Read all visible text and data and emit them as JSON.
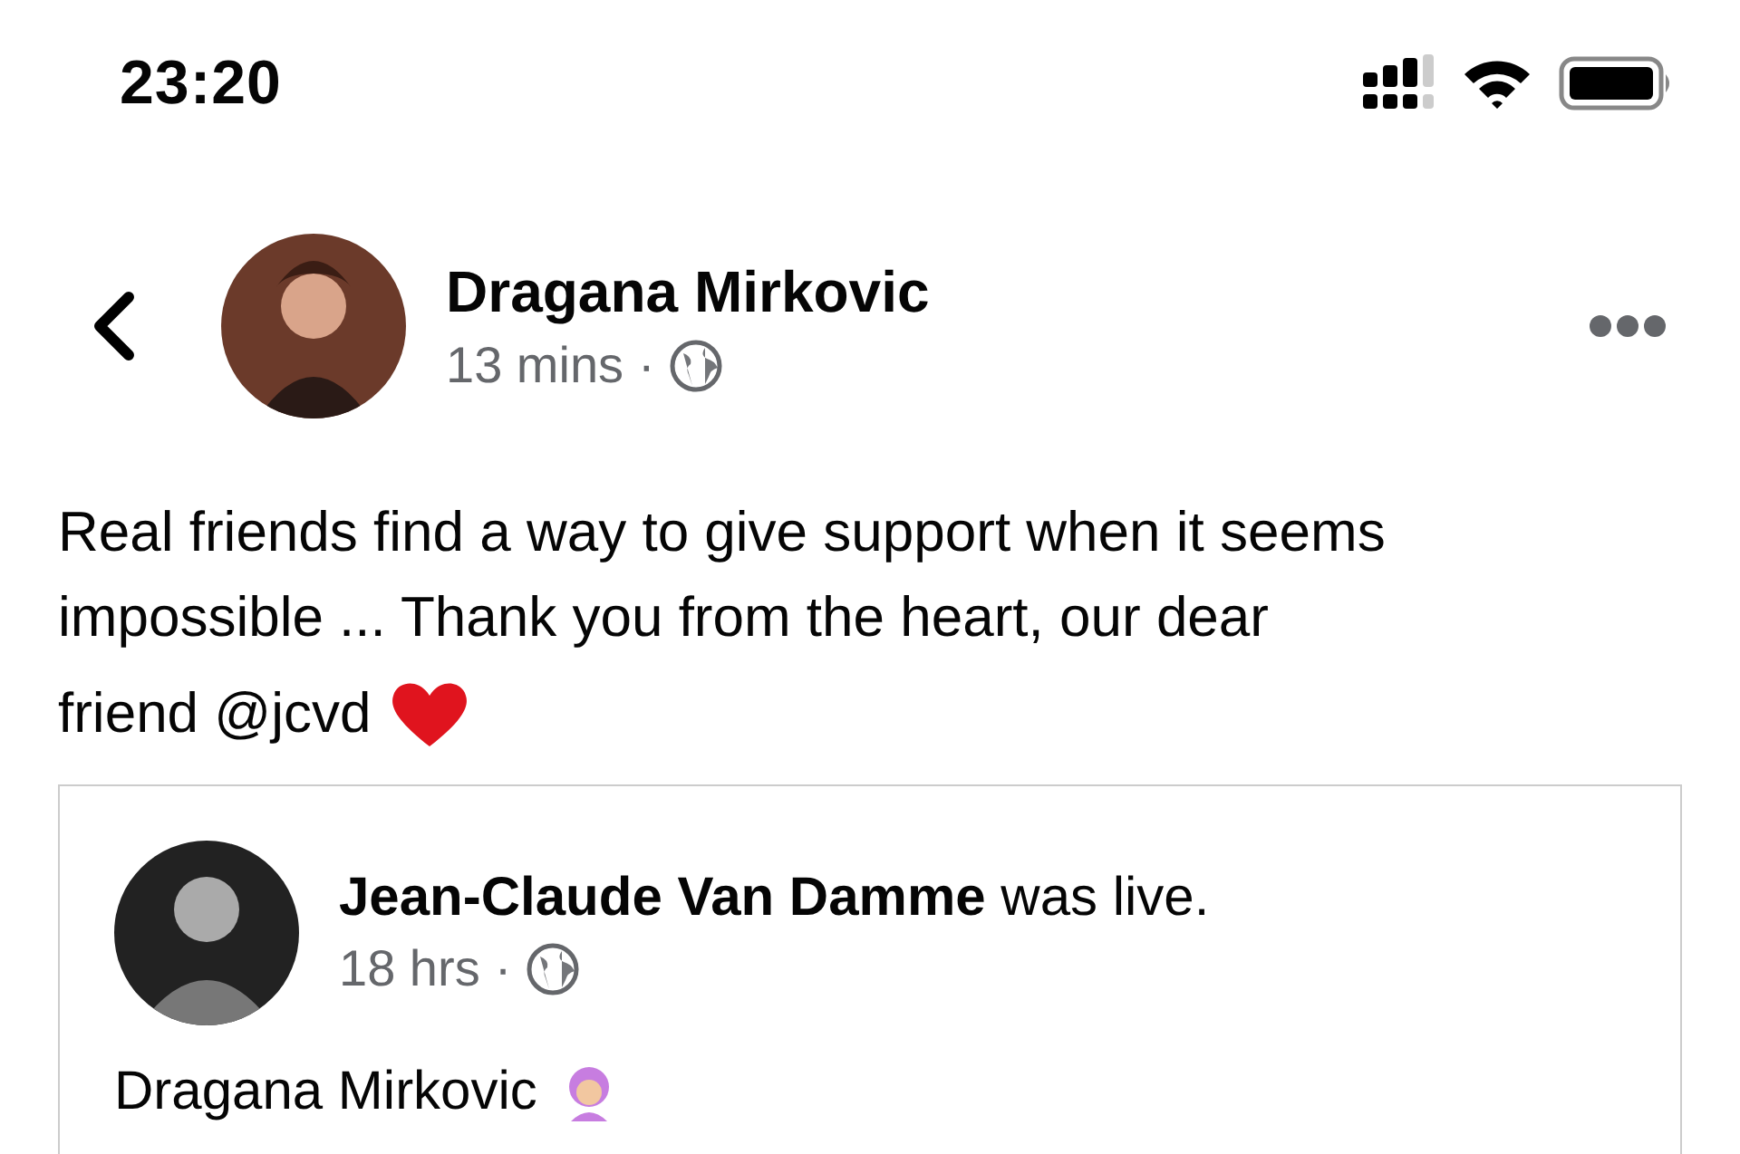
{
  "status_bar": {
    "time": "23:20"
  },
  "post": {
    "author": "Dragana Mirkovic",
    "time": "13 mins",
    "separator": "·",
    "text_lines": [
      "Real friends find a way to give support when it seems",
      "impossible ... Thank you from the heart, our dear",
      "friend @jcvd"
    ]
  },
  "shared_post": {
    "headline": "**Jean-Claude Van Damme** was live.",
    "time": "18 hrs",
    "separator": "·",
    "caption": "Dragana Mirkovic"
  }
}
